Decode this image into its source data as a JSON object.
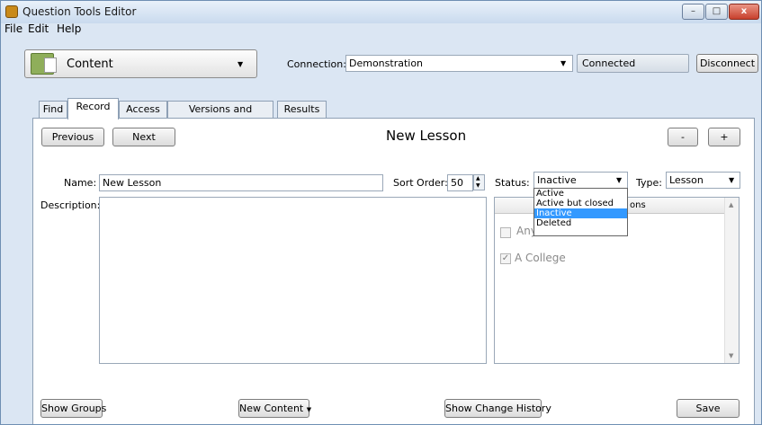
{
  "window": {
    "title": "Question Tools Editor",
    "minimize": "–",
    "maximize": "□",
    "close": "x"
  },
  "menu": {
    "items": [
      "File",
      "Edit",
      "Help"
    ]
  },
  "toolbar": {
    "content_label": "Content",
    "connection_label": "Connection:",
    "connection_value": "Demonstration",
    "status_text": "Connected",
    "disconnect_label": "Disconnect"
  },
  "tabs": [
    "Find",
    "Record",
    "Access",
    "Versions and Screens",
    "Results"
  ],
  "record": {
    "previous_label": "Previous",
    "next_label": "Next",
    "heading": "New Lesson",
    "minus_label": "-",
    "plus_label": "+",
    "name_label": "Name:",
    "name_value": "New Lesson",
    "sort_order_label": "Sort Order:",
    "sort_order_value": "50",
    "status_label": "Status:",
    "status_value": "Inactive",
    "type_label": "Type:",
    "type_value": "Lesson",
    "description_label": "Description:",
    "status_options": [
      "Active",
      "Active but closed",
      "Inactive",
      "Deleted"
    ],
    "list_header_fragment": "ons",
    "list_items": [
      {
        "label_fragment": "Any",
        "checked": false
      },
      {
        "label": "A College",
        "checked": true
      }
    ]
  },
  "footer": {
    "show_groups_label": "Show Groups",
    "new_content_label": "New Content",
    "show_change_history_label": "Show Change History",
    "save_label": "Save"
  },
  "colors": {
    "selection": "#3399ff",
    "window_bg": "#dbe6f3"
  }
}
